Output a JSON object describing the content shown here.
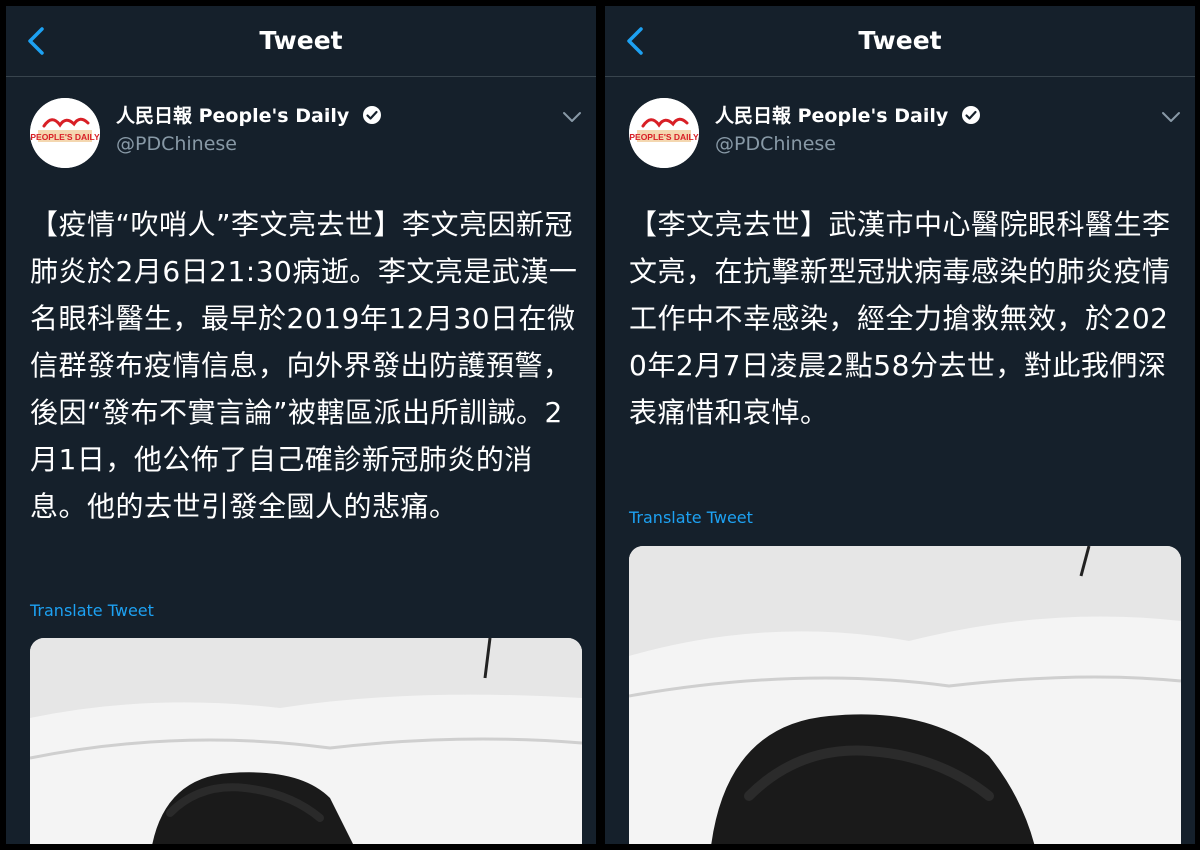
{
  "tweets": [
    {
      "header_title": "Tweet",
      "author": {
        "name": "人民日報 People's Daily",
        "handle": "@PDChinese",
        "logo_text": "PEOPLE'S DAILY"
      },
      "text": "【疫情“吹哨人”李文亮去世】李文亮因新冠肺炎於2月6日21:30病逝。李文亮是武漢一名眼科醫生，最早於2019年12月30日在微信群發布疫情信息，向外界發出防護預警，後因“發布不實言論”被轄區派出所訓誡。2月1日，他公佈了自己確診新冠肺炎的消息。他的去世引發全國人的悲痛。",
      "translate_label": "Translate Tweet"
    },
    {
      "header_title": "Tweet",
      "author": {
        "name": "人民日報 People's Daily",
        "handle": "@PDChinese",
        "logo_text": "PEOPLE'S DAILY"
      },
      "text": "【李文亮去世】武漢市中心醫院眼科醫生李文亮，在抗擊新型冠狀病毒感染的肺炎疫情工作中不幸感染，經全力搶救無效，於2020年2月7日凌晨2點58分去世，對此我們深表痛惜和哀悼。",
      "translate_label": "Translate Tweet"
    }
  ],
  "icons": {
    "back": "chevron-left-icon",
    "verified": "verified-badge-icon",
    "menu": "chevron-down-icon"
  },
  "colors": {
    "background": "#15202b",
    "link": "#1da1f2",
    "secondary_text": "#8899a6",
    "logo_red": "#d81f26"
  }
}
